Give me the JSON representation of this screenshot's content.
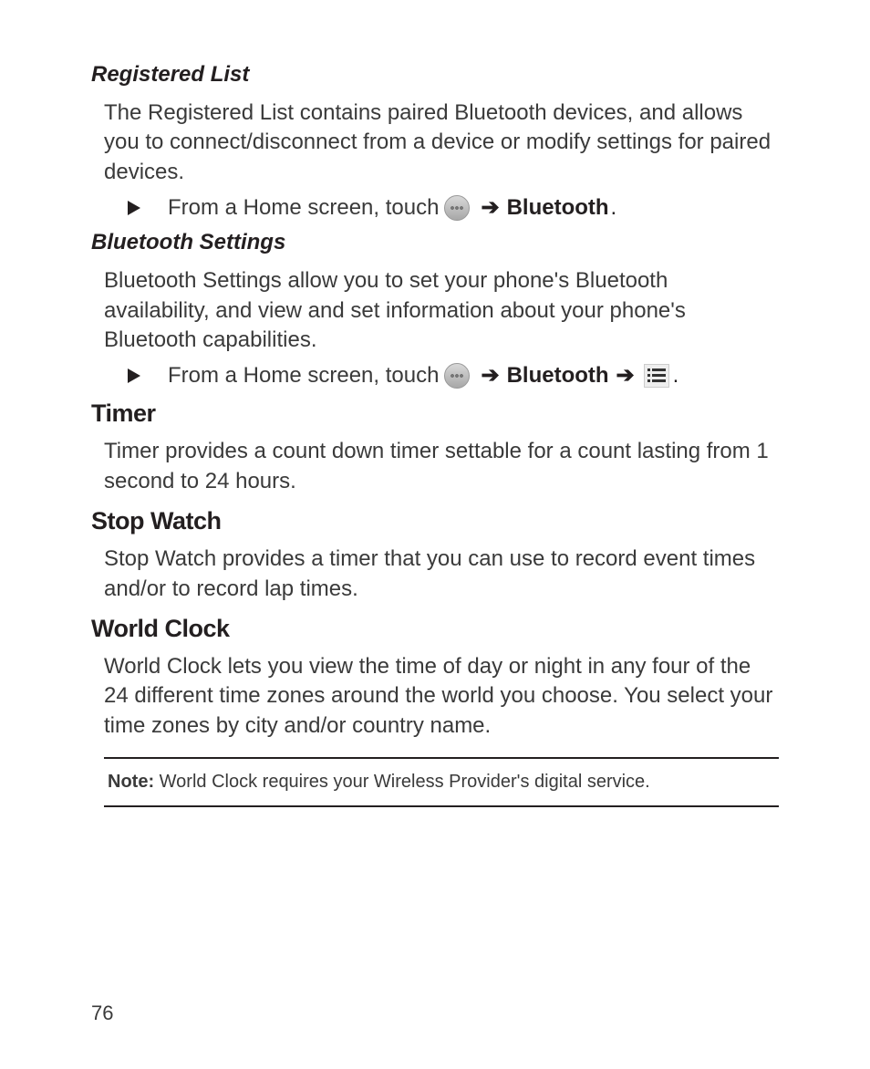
{
  "sections": {
    "registered_list": {
      "heading": "Registered List",
      "body": "The Registered List contains paired Bluetooth devices, and allows you to connect/disconnect from a device or modify settings for paired devices.",
      "step_prefix": "From a Home screen, touch ",
      "step_bold": "Bluetooth"
    },
    "bluetooth_settings": {
      "heading": "Bluetooth Settings",
      "body": "Bluetooth Settings allow you to set your phone's Bluetooth availability, and view and set information about your phone's Bluetooth capabilities.",
      "step_prefix": "From a Home screen, touch ",
      "step_bold": "Bluetooth"
    },
    "timer": {
      "heading": "Timer",
      "body": "Timer provides a count down timer settable for a count lasting from 1 second to 24 hours."
    },
    "stop_watch": {
      "heading": "Stop Watch",
      "body": "Stop Watch provides a timer that you can use to record event times and/or to record lap times."
    },
    "world_clock": {
      "heading": "World Clock",
      "body": "World Clock lets you view the time of day or night in any four of the 24 different time zones around the world you choose. You select your time zones by city and/or country name."
    }
  },
  "note": {
    "label": "Note:",
    "text": " World Clock requires your Wireless Provider's digital service."
  },
  "arrow_glyph": "➔",
  "page_number": "76"
}
